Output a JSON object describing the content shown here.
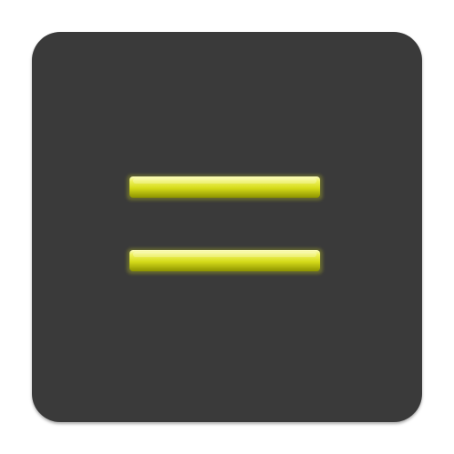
{
  "icon": {
    "name": "equals-sign-icon",
    "colors": {
      "tile_background": "#3a3a3a",
      "bar_light": "#f4f58a",
      "bar_main": "#d6dc1a",
      "bar_dark": "#8f9500",
      "bar_glow": "#c9cf27"
    }
  }
}
